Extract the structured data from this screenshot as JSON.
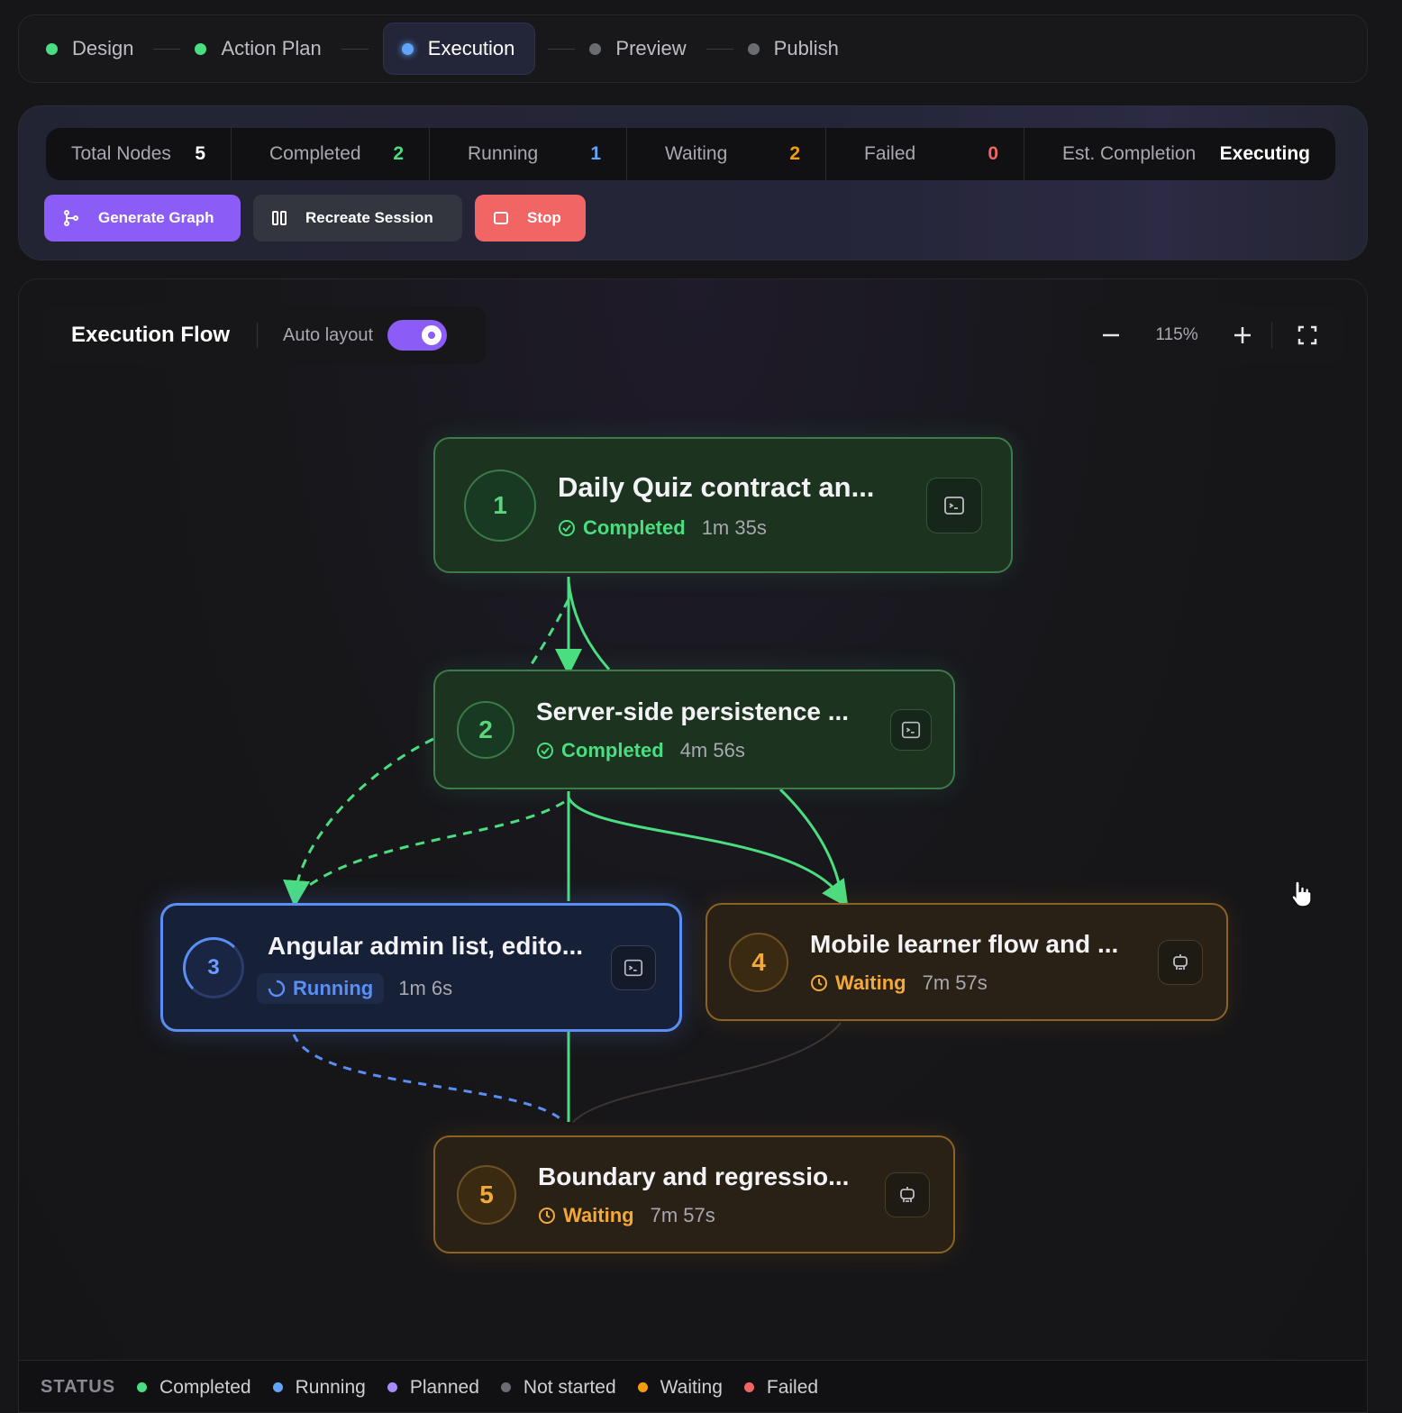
{
  "stepper": [
    {
      "label": "Design",
      "color": "#4ade80",
      "active": false
    },
    {
      "label": "Action Plan",
      "color": "#4ade80",
      "active": false
    },
    {
      "label": "Execution",
      "color": "#60a5fa",
      "active": true
    },
    {
      "label": "Preview",
      "color": "#6b6b72",
      "active": false
    },
    {
      "label": "Publish",
      "color": "#6b6b72",
      "active": false
    }
  ],
  "stats": {
    "total": {
      "label": "Total Nodes",
      "value": "5",
      "color": "#ffffff"
    },
    "completed": {
      "label": "Completed",
      "value": "2",
      "color": "#4ade80"
    },
    "running": {
      "label": "Running",
      "value": "1",
      "color": "#60a5fa"
    },
    "waiting": {
      "label": "Waiting",
      "value": "2",
      "color": "#f59e0b"
    },
    "failed": {
      "label": "Failed",
      "value": "0",
      "color": "#f16565"
    },
    "eta": {
      "label": "Est. Completion",
      "value": "Executing",
      "color": "#ffffff"
    }
  },
  "buttons": {
    "generate": "Generate Graph",
    "recreate": "Recreate Session",
    "stop": "Stop"
  },
  "flow": {
    "title": "Execution Flow",
    "auto_layout_label": "Auto layout",
    "auto_layout_on": true,
    "zoom": "115%"
  },
  "nodes": [
    {
      "num": "1",
      "title": "Daily Quiz contract an...",
      "status": "Completed",
      "time": "1m 35s",
      "icon": "terminal-icon"
    },
    {
      "num": "2",
      "title": "Server-side persistence ...",
      "status": "Completed",
      "time": "4m 56s",
      "icon": "terminal-icon"
    },
    {
      "num": "3",
      "title": "Angular admin list, edito...",
      "status": "Running",
      "time": "1m 6s",
      "icon": "terminal-icon"
    },
    {
      "num": "4",
      "title": "Mobile learner flow and ...",
      "status": "Waiting",
      "time": "7m 57s",
      "icon": "robot-icon"
    },
    {
      "num": "5",
      "title": "Boundary and regressio...",
      "status": "Waiting",
      "time": "7m 57s",
      "icon": "robot-icon"
    }
  ],
  "legend": {
    "title": "STATUS",
    "items": [
      {
        "label": "Completed",
        "color": "#4ade80"
      },
      {
        "label": "Running",
        "color": "#60a5fa"
      },
      {
        "label": "Planned",
        "color": "#a78bfa"
      },
      {
        "label": "Not started",
        "color": "#6b6b72"
      },
      {
        "label": "Waiting",
        "color": "#f59e0b"
      },
      {
        "label": "Failed",
        "color": "#f16565"
      }
    ]
  }
}
